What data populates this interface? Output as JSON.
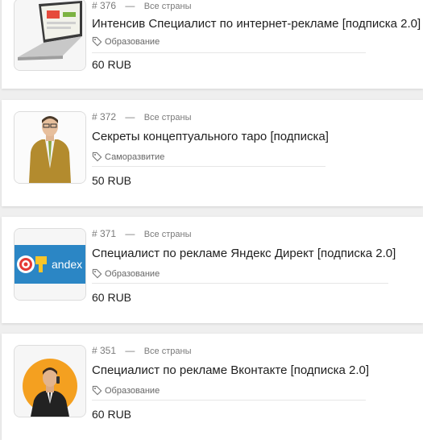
{
  "items": [
    {
      "id": "# 376",
      "dash": "—",
      "country": "Все страны",
      "title": "Интенсив Специалист по интернет-рекламе [подписка 2.0]",
      "category": "Образование",
      "price": "60 RUB",
      "thumb_icon": "laptop-image"
    },
    {
      "id": "# 372",
      "dash": "—",
      "country": "Все страны",
      "title": "Секреты концептуального таро [подписка]",
      "category": "Саморазвитие",
      "price": "50 RUB",
      "thumb_icon": "man-in-suit-photo"
    },
    {
      "id": "# 371",
      "dash": "—",
      "country": "Все страны",
      "title": "Специалист по рекламе Яндекс Директ [подписка 2.0]",
      "category": "Образование",
      "price": "60 RUB",
      "thumb_icon": "yandex-direct-banner",
      "thumb_text": "andex"
    },
    {
      "id": "# 351",
      "dash": "—",
      "country": "Все страны",
      "title": "Специалист по рекламе Вконтакте [подписка 2.0]",
      "category": "Образование",
      "price": "60 RUB",
      "thumb_icon": "businessman-orange-circle"
    }
  ],
  "colors": {
    "page_bg": "#efefef",
    "card_bg": "#ffffff",
    "text": "#1f1f1f",
    "muted": "#7a7a7a",
    "yandex_blue": "#2b86c5",
    "orange": "#f4a020"
  }
}
